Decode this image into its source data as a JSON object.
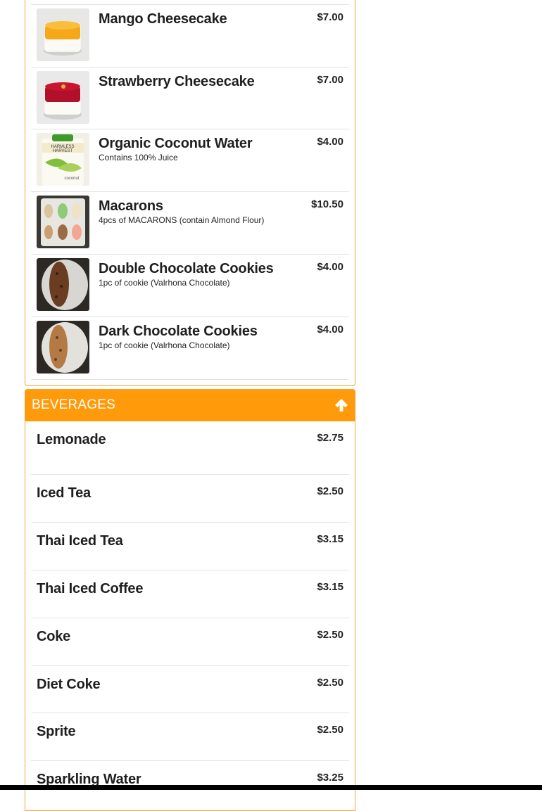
{
  "desserts": {
    "items": [
      {
        "name": "Mango Cheesecake",
        "desc": "",
        "price": "$7.00",
        "image": "mango-cheesecake-photo"
      },
      {
        "name": "Strawberry Cheesecake",
        "desc": "",
        "price": "$7.00",
        "image": "strawberry-cheesecake-photo"
      },
      {
        "name": "Organic Coconut Water",
        "desc": "Contains 100% Juice",
        "price": "$4.00",
        "image": "coconut-water-photo"
      },
      {
        "name": "Macarons",
        "desc": "4pcs of MACARONS (contain Almond Flour)",
        "price": "$10.50",
        "image": "macarons-photo"
      },
      {
        "name": "Double Chocolate Cookies",
        "desc": "1pc of cookie (Valrhona Chocolate)",
        "price": "$4.00",
        "image": "double-chocolate-cookie-photo"
      },
      {
        "name": "Dark Chocolate Cookies",
        "desc": "1pc of cookie (Valrhona Chocolate)",
        "price": "$4.00",
        "image": "dark-chocolate-cookie-photo"
      }
    ]
  },
  "beverages": {
    "title": "BEVERAGES",
    "collapse_icon": "arrow-up-icon",
    "items": [
      {
        "name": "Lemonade",
        "price": "$2.75"
      },
      {
        "name": "Iced Tea",
        "price": "$2.50"
      },
      {
        "name": "Thai Iced Tea",
        "price": "$3.15"
      },
      {
        "name": "Thai Iced Coffee",
        "price": "$3.15"
      },
      {
        "name": "Coke",
        "price": "$2.50"
      },
      {
        "name": "Diet Coke",
        "price": "$2.50"
      },
      {
        "name": "Sprite",
        "price": "$2.50"
      },
      {
        "name": "Sparkling Water",
        "price": "$3.25"
      }
    ]
  },
  "colors": {
    "accent": "#ff9a0a",
    "border": "#f0a638",
    "divider": "#e3e3e3"
  }
}
